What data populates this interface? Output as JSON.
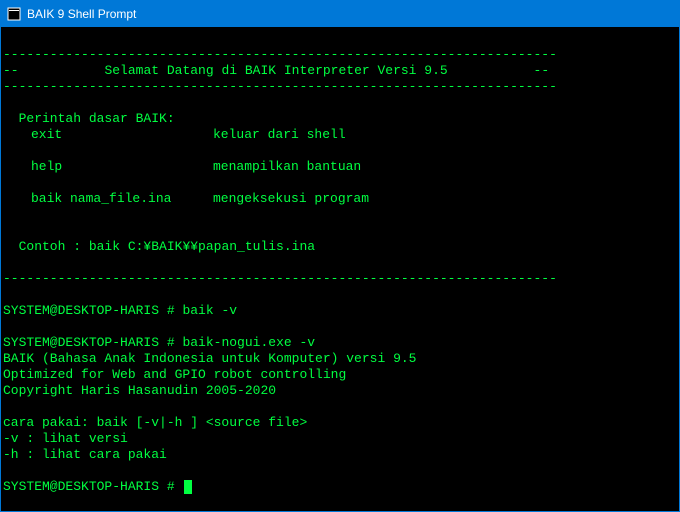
{
  "titlebar": {
    "text": "BAIK 9 Shell Prompt"
  },
  "dashes": {
    "full": "-----------------------------------------------------------------------",
    "prefix": "--",
    "suffix": "--"
  },
  "welcome": "Selamat Datang di BAIK Interpreter Versi 9.5",
  "commands": {
    "header": "  Perintah dasar BAIK:",
    "items": [
      {
        "cmd": "exit",
        "desc": "keluar dari shell"
      },
      {
        "cmd": "help",
        "desc": "menampilkan bantuan"
      },
      {
        "cmd": "baik nama_file.ina",
        "desc": "mengeksekusi program"
      }
    ],
    "example_label": "  Contoh : ",
    "example_path": "baik C:¥BAIK¥¥papan_tulis.ina"
  },
  "session": {
    "prompt": "SYSTEM@DESKTOP-HARIS #",
    "cmd1": "baik -v",
    "cmd2": "baik-nogui.exe -v",
    "output": [
      "BAIK (Bahasa Anak Indonesia untuk Komputer) versi 9.5",
      "Optimized for Web and GPIO robot controlling",
      "Copyright Haris Hasanudin 2005-2020"
    ],
    "usage_header": "cara pakai: baik [-v|-h ] <source file>",
    "usage_lines": [
      "-v : lihat versi",
      "-h : lihat cara pakai"
    ]
  }
}
